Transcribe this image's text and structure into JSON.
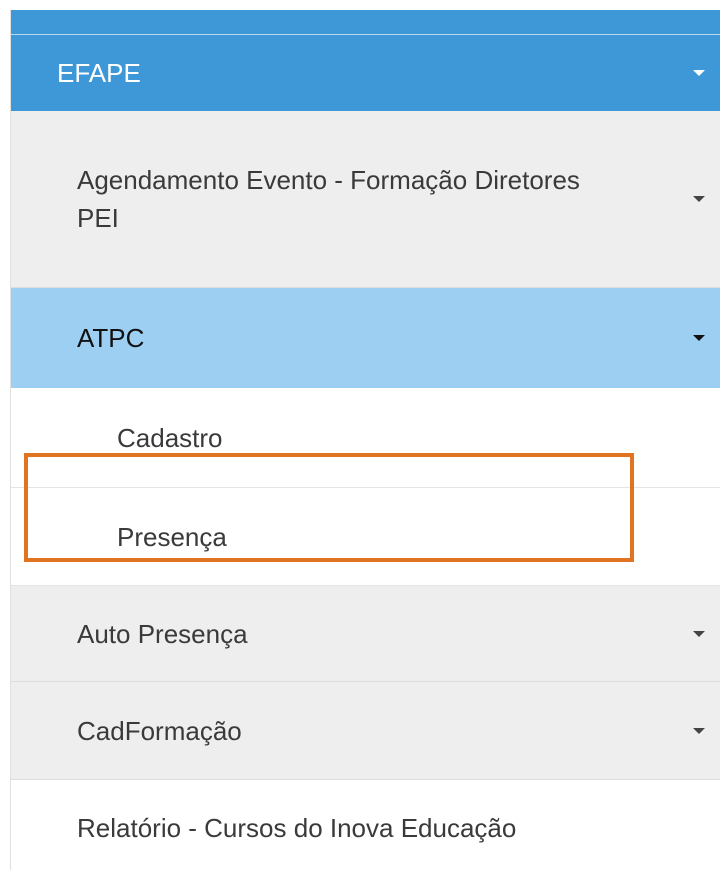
{
  "menu": {
    "section": {
      "label": "EFAPE",
      "icon": "caret-down-icon"
    },
    "items": [
      {
        "label": "Agendamento Evento - Formação Diretores PEI",
        "expandable": true
      },
      {
        "label": "ATPC",
        "expandable": true,
        "active": true
      },
      {
        "label": "Auto Presença",
        "expandable": true
      },
      {
        "label": "CadFormação",
        "expandable": true
      },
      {
        "label": "Relatório - Cursos do Inova Educação",
        "expandable": false
      }
    ],
    "atpc_subitems": [
      {
        "label": "Cadastro"
      },
      {
        "label": "Presença",
        "highlighted": true
      }
    ]
  },
  "colors": {
    "primary": "#3e98d7",
    "active_light": "#9ccff2",
    "item_bg": "#eeeeee",
    "highlight_border": "#e07420"
  }
}
